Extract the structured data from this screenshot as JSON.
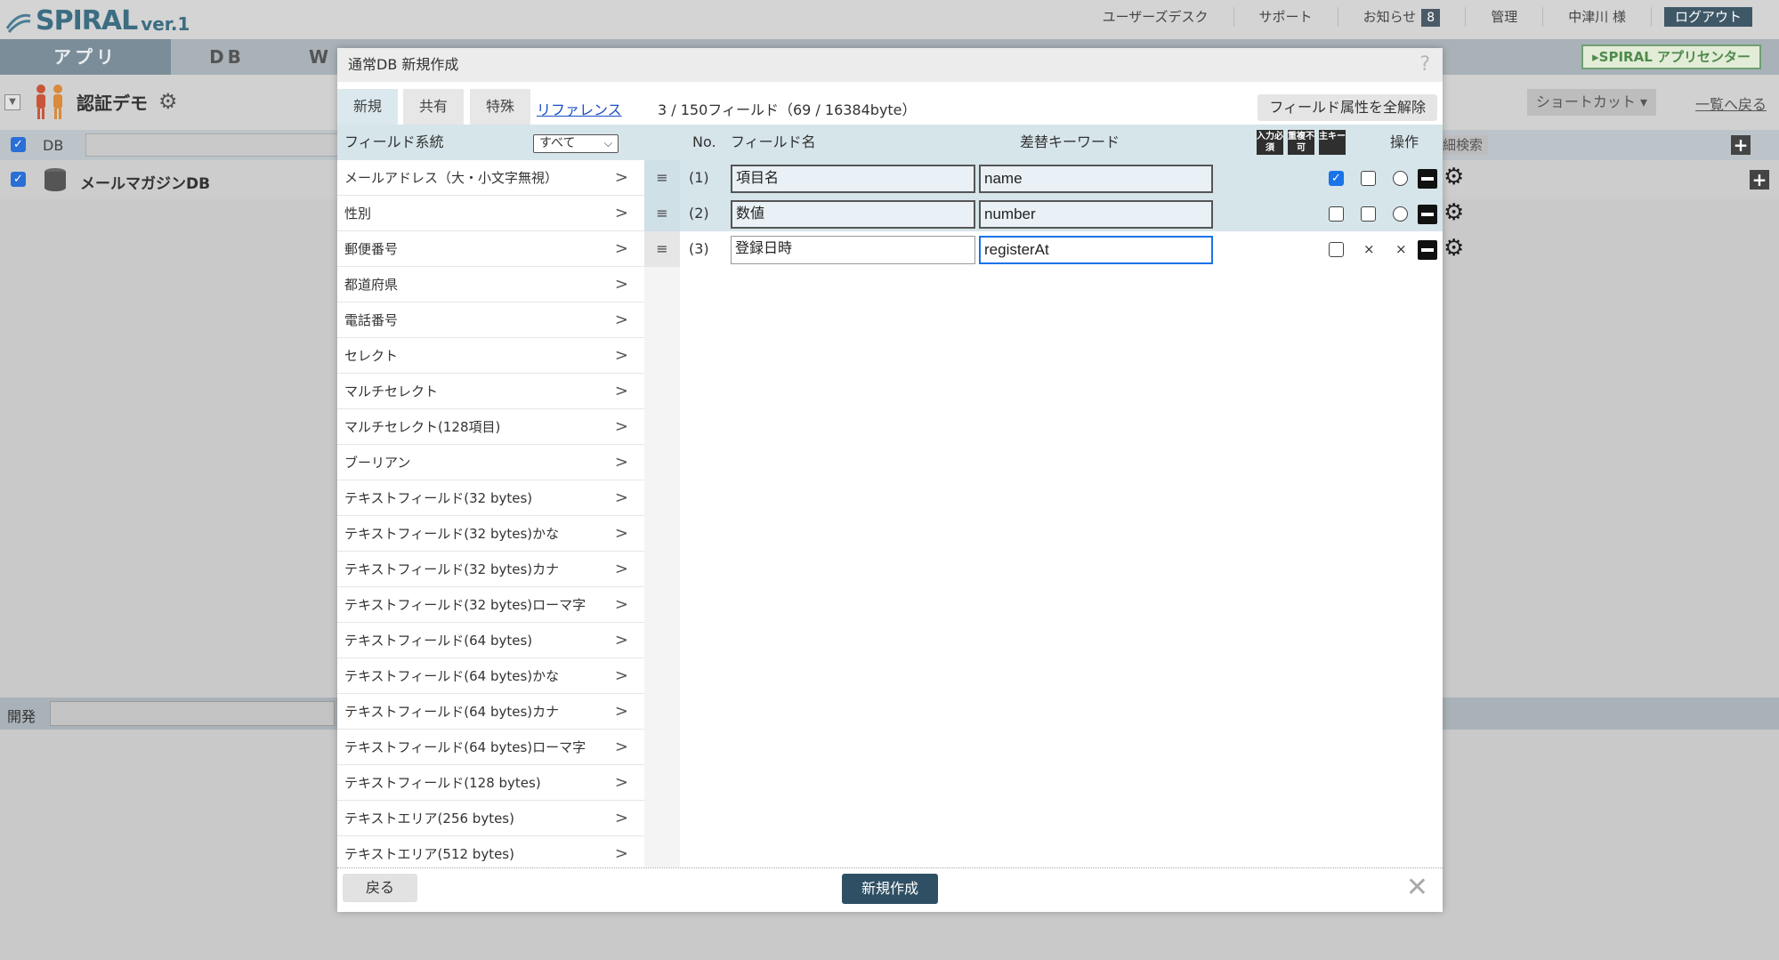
{
  "header": {
    "logo_text": "SPIRAL",
    "logo_version": "ver.1",
    "nav": {
      "user_desk": "ユーザーズデスク",
      "support": "サポート",
      "notice": "お知らせ",
      "notice_count": "8",
      "admin": "管理",
      "user_name": "中津川 様",
      "logout": "ログアウト"
    }
  },
  "main_tabs": {
    "app": "アプリ",
    "db": "DB",
    "w": "W"
  },
  "app_center_label": "▸SPIRAL アプリセンター",
  "app": {
    "name": "認証デモ",
    "shortcut": "ショートカット",
    "back_to_list": "一覧へ戻る"
  },
  "db_section": {
    "label": "DB",
    "detail_search": "細検索",
    "rows": [
      {
        "name": "メールマガジンDB"
      }
    ]
  },
  "dev_section": {
    "label": "開発"
  },
  "modal": {
    "title": "通常DB 新規作成",
    "help": "?",
    "tabs": {
      "new": "新規",
      "shared": "共有",
      "special": "特殊",
      "reference": "リファレンス"
    },
    "field_count": "3 / 150フィールド（69 / 16384byte）",
    "clear_attr": "フィールド属性を全解除",
    "columns": {
      "field_type": "フィールド系統",
      "filter_value": "すべて",
      "no": "No.",
      "field_name": "フィールド名",
      "keyword": "差替キーワード",
      "attr_required": "入力必須",
      "attr_unique": "重複不可",
      "attr_key": "主キー",
      "ops": "操作"
    },
    "field_types": [
      "メールアドレス（大・小文字無視）",
      "性別",
      "郵便番号",
      "都道府県",
      "電話番号",
      "セレクト",
      "マルチセレクト",
      "マルチセレクト(128項目)",
      "ブーリアン",
      "テキストフィールド(32 bytes)",
      "テキストフィールド(32 bytes)かな",
      "テキストフィールド(32 bytes)カナ",
      "テキストフィールド(32 bytes)ローマ字",
      "テキストフィールド(64 bytes)",
      "テキストフィールド(64 bytes)かな",
      "テキストフィールド(64 bytes)カナ",
      "テキストフィールド(64 bytes)ローマ字",
      "テキストフィールド(128 bytes)",
      "テキストエリア(256 bytes)",
      "テキストエリア(512 bytes)"
    ],
    "fields": [
      {
        "no": "(1)",
        "name": "項目名",
        "keyword": "name",
        "required": true
      },
      {
        "no": "(2)",
        "name": "数値",
        "keyword": "number",
        "required": false
      },
      {
        "no": "(3)",
        "name": "登録日時",
        "keyword": "registerAt",
        "required": false
      }
    ],
    "drag_handle": "≡",
    "arrow": ">",
    "na": "×",
    "back_button": "戻る",
    "create_button": "新規作成",
    "close": "✕"
  }
}
